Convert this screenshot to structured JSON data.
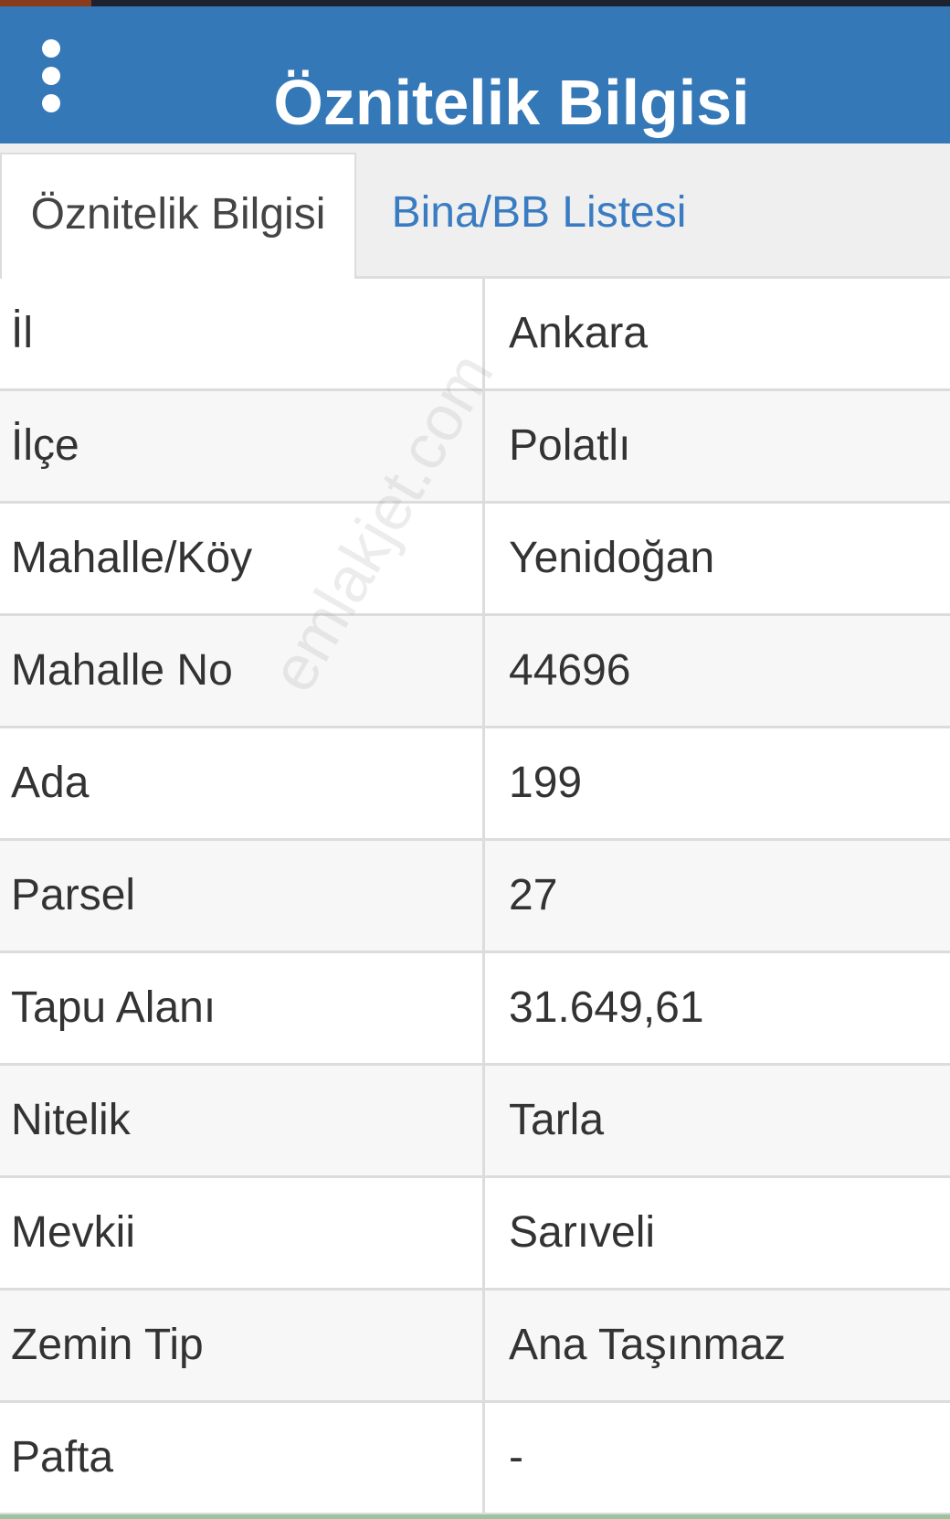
{
  "header": {
    "title": "Öznitelik Bilgisi",
    "menu_icon": "vertical-ellipsis-icon",
    "color": "#3578b8"
  },
  "tabs": [
    {
      "label": "Öznitelik Bilgisi",
      "active": true
    },
    {
      "label": "Bina/BB Listesi",
      "active": false
    }
  ],
  "rows": [
    {
      "key": "İl",
      "value": "Ankara"
    },
    {
      "key": "İlçe",
      "value": "Polatlı"
    },
    {
      "key": "Mahalle/Köy",
      "value": "Yenidoğan"
    },
    {
      "key": "Mahalle No",
      "value": "44696"
    },
    {
      "key": "Ada",
      "value": "199"
    },
    {
      "key": "Parsel",
      "value": "27"
    },
    {
      "key": "Tapu Alanı",
      "value": "31.649,61"
    },
    {
      "key": "Nitelik",
      "value": "Tarla"
    },
    {
      "key": "Mevkii",
      "value": "Sarıveli"
    },
    {
      "key": "Zemin Tip",
      "value": "Ana Taşınmaz"
    },
    {
      "key": "Pafta",
      "value": "-"
    }
  ],
  "watermark": "emlakjet.com"
}
